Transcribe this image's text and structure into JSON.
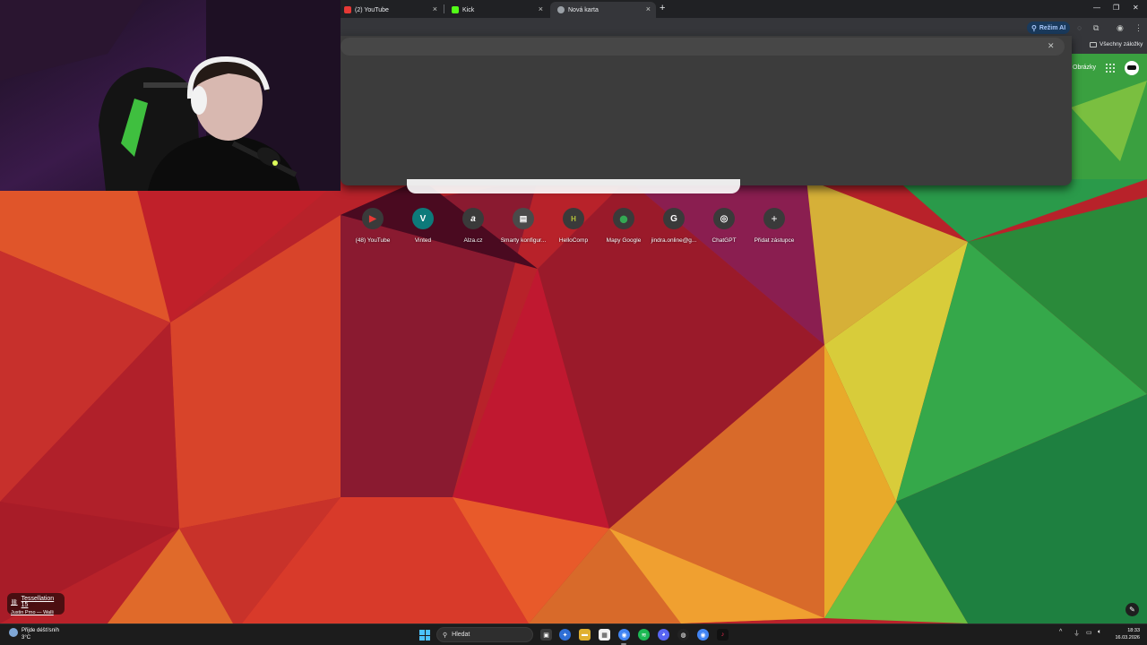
{
  "browser": {
    "tabs": [
      {
        "label": "(2) YouTube",
        "icon": "youtube-icon",
        "active": false
      },
      {
        "label": "Kick",
        "icon": "kick-icon",
        "active": false
      },
      {
        "label": "Nová karta",
        "icon": "globe-icon",
        "active": true
      }
    ],
    "new_tab_glyph": "+",
    "toolbar": {
      "ai_mode_label": "Režim AI"
    },
    "bookmarks": {
      "all_bookmarks_label": "Všechny záložky"
    }
  },
  "newtab_page": {
    "images_link": "Obrázky",
    "shortcuts": [
      {
        "label": "(48) YouTube",
        "glyph": "▶",
        "color": "#e53935"
      },
      {
        "label": "Vinted",
        "glyph": "V",
        "color": "#0d7a7a"
      },
      {
        "label": "Alza.cz",
        "glyph": "a",
        "color": "#3a3a3a"
      },
      {
        "label": "Smarty konfigur...",
        "glyph": "▤",
        "color": "#4a4a4a"
      },
      {
        "label": "HelloComp",
        "glyph": "H",
        "color": "#5a6a2a"
      },
      {
        "label": "Mapy Google",
        "glyph": "⬤",
        "color": "#3a3a3a"
      },
      {
        "label": "jindra.online@g...",
        "glyph": "G",
        "color": "#3a3a3a"
      },
      {
        "label": "ChatGPT",
        "glyph": "◎",
        "color": "#3a3a3a"
      },
      {
        "label": "Přidat zástupce",
        "glyph": "+",
        "color": "#3a3a3a"
      }
    ],
    "attribution": {
      "title": "Tessellation 15",
      "author": "Justin Prno — Walli"
    }
  },
  "taskbar": {
    "weather": {
      "text": "Přijde déšť/sníh",
      "temp": "3°C"
    },
    "search_label": "Hledat",
    "clock": {
      "time": "18:33",
      "date": "16.03.2026"
    },
    "accent": "#4cc2ff"
  }
}
